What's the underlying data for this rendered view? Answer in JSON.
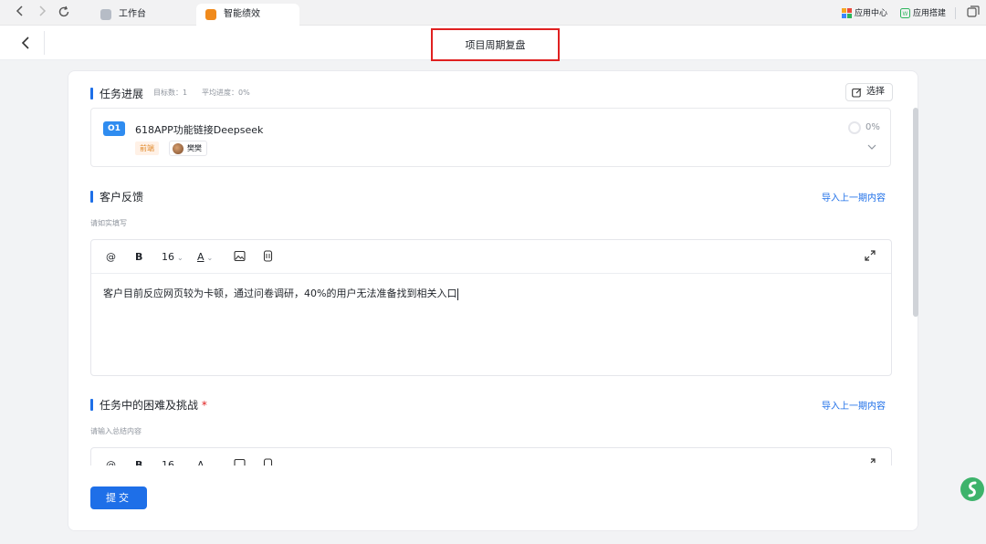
{
  "browser": {
    "tabs": [
      {
        "label": "工作台",
        "icon": "workbench-icon",
        "active": false
      },
      {
        "label": "智能绩效",
        "icon": "performance-app-icon",
        "active": true
      }
    ],
    "right_items": [
      {
        "label": "应用中心",
        "icon": "app-center-icon"
      },
      {
        "label": "应用搭建",
        "icon": "app-builder-icon"
      }
    ]
  },
  "header": {
    "title": "项目周期复盘"
  },
  "task_section": {
    "title": "任务进展",
    "target_count": "目标数：1",
    "avg_progress": "平均进度：0%",
    "select_label": "选择",
    "task": {
      "badge": "O1",
      "name": "618APP功能链接Deepseek",
      "tag": "前端",
      "owner": "樊樊",
      "progress": "0%"
    }
  },
  "feedback_section": {
    "title": "客户反馈",
    "import_label": "导入上一期内容",
    "hint": "请如实填写",
    "font_size": "16",
    "content": "客户目前反应网页较为卡顿，通过问卷调研，40%的用户无法准备找到相关入口"
  },
  "challenge_section": {
    "title": "任务中的困难及挑战",
    "required_mark": "*",
    "import_label": "导入上一期内容",
    "hint": "请输入总结内容",
    "font_size": "16"
  },
  "submit_label": "提交",
  "colors": {
    "accent": "#1e6fe8",
    "highlight": "#e02020"
  }
}
